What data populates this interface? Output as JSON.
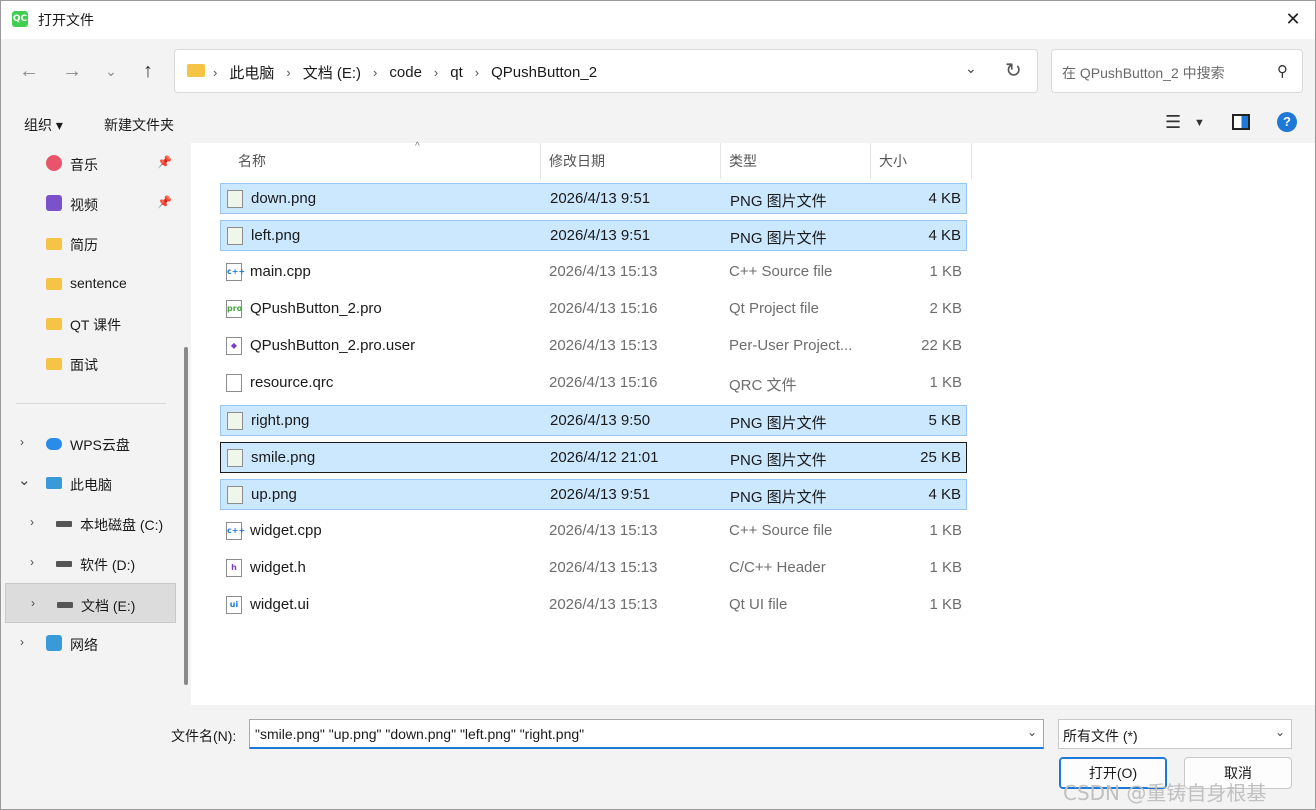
{
  "window": {
    "title": "打开文件"
  },
  "nav": {
    "breadcrumbs": [
      "此电脑",
      "文档 (E:)",
      "code",
      "qt",
      "QPushButton_2"
    ],
    "search_placeholder": "在 QPushButton_2 中搜索"
  },
  "toolbar": {
    "organize_label": "组织 ▾",
    "new_folder_label": "新建文件夹"
  },
  "sidebar": {
    "quick": [
      {
        "label": "音乐",
        "icon": "music-icon",
        "pinned": true
      },
      {
        "label": "视频",
        "icon": "video-icon",
        "pinned": true
      },
      {
        "label": "简历",
        "icon": "folder-icon",
        "pinned": false
      },
      {
        "label": "sentence",
        "icon": "folder-icon",
        "pinned": false
      },
      {
        "label": "QT 课件",
        "icon": "folder-icon",
        "pinned": false
      },
      {
        "label": "面试",
        "icon": "folder-icon",
        "pinned": false
      }
    ],
    "tree": [
      {
        "label": "WPS云盘",
        "icon": "cloud-icon",
        "chevron": "›"
      },
      {
        "label": "此电脑",
        "icon": "computer-icon",
        "chevron": "⌄"
      },
      {
        "label": "本地磁盘 (C:)",
        "icon": "drive-icon",
        "chevron": "›"
      },
      {
        "label": "软件 (D:)",
        "icon": "drive-icon",
        "chevron": "›"
      },
      {
        "label": "文档 (E:)",
        "icon": "drive-icon",
        "chevron": "›",
        "selected": true
      },
      {
        "label": "网络",
        "icon": "network-icon",
        "chevron": "›"
      }
    ]
  },
  "columns": {
    "name": "名称",
    "date": "修改日期",
    "type": "类型",
    "size": "大小"
  },
  "files": [
    {
      "name": "down.png",
      "date": "2026/4/13 9:51",
      "type": "PNG 图片文件",
      "size": "4 KB",
      "icon": "png-file-icon",
      "badge": "",
      "selected": true
    },
    {
      "name": "left.png",
      "date": "2026/4/13 9:51",
      "type": "PNG 图片文件",
      "size": "4 KB",
      "icon": "png-file-icon",
      "badge": "",
      "selected": true
    },
    {
      "name": "main.cpp",
      "date": "2026/4/13 15:13",
      "type": "C++ Source file",
      "size": "1 KB",
      "icon": "cpp-file-icon",
      "badge": "c++",
      "selected": false
    },
    {
      "name": "QPushButton_2.pro",
      "date": "2026/4/13 15:16",
      "type": "Qt Project file",
      "size": "2 KB",
      "icon": "pro-file-icon",
      "badge": "pro",
      "selected": false
    },
    {
      "name": "QPushButton_2.pro.user",
      "date": "2026/4/13 15:13",
      "type": "Per-User Project...",
      "size": "22 KB",
      "icon": "user-file-icon",
      "badge": "◆",
      "selected": false
    },
    {
      "name": "resource.qrc",
      "date": "2026/4/13 15:16",
      "type": "QRC 文件",
      "size": "1 KB",
      "icon": "qrc-file-icon",
      "badge": "",
      "selected": false
    },
    {
      "name": "right.png",
      "date": "2026/4/13 9:50",
      "type": "PNG 图片文件",
      "size": "5 KB",
      "icon": "png-file-icon",
      "badge": "",
      "selected": true
    },
    {
      "name": "smile.png",
      "date": "2026/4/12 21:01",
      "type": "PNG 图片文件",
      "size": "25 KB",
      "icon": "png-file-icon",
      "badge": "",
      "selected": true,
      "focused": true
    },
    {
      "name": "up.png",
      "date": "2026/4/13 9:51",
      "type": "PNG 图片文件",
      "size": "4 KB",
      "icon": "png-file-icon",
      "badge": "",
      "selected": true
    },
    {
      "name": "widget.cpp",
      "date": "2026/4/13 15:13",
      "type": "C++ Source file",
      "size": "1 KB",
      "icon": "cpp-file-icon",
      "badge": "c++",
      "selected": false
    },
    {
      "name": "widget.h",
      "date": "2026/4/13 15:13",
      "type": "C/C++ Header",
      "size": "1 KB",
      "icon": "header-file-icon",
      "badge": "h",
      "selected": false
    },
    {
      "name": "widget.ui",
      "date": "2026/4/13 15:13",
      "type": "Qt UI file",
      "size": "1 KB",
      "icon": "ui-file-icon",
      "badge": "ui",
      "selected": false
    }
  ],
  "footer": {
    "filename_label": "文件名(N):",
    "filename_value": "\"smile.png\" \"up.png\" \"down.png\" \"left.png\" \"right.png\"",
    "filter_value": "所有文件 (*)",
    "open_label": "打开(O)",
    "cancel_label": "取消",
    "watermark": "CSDN @重铸自身根基"
  },
  "colors": {
    "accent": "#1e78d7",
    "selection": "#cce8ff",
    "selection_border": "#99c6f0"
  }
}
